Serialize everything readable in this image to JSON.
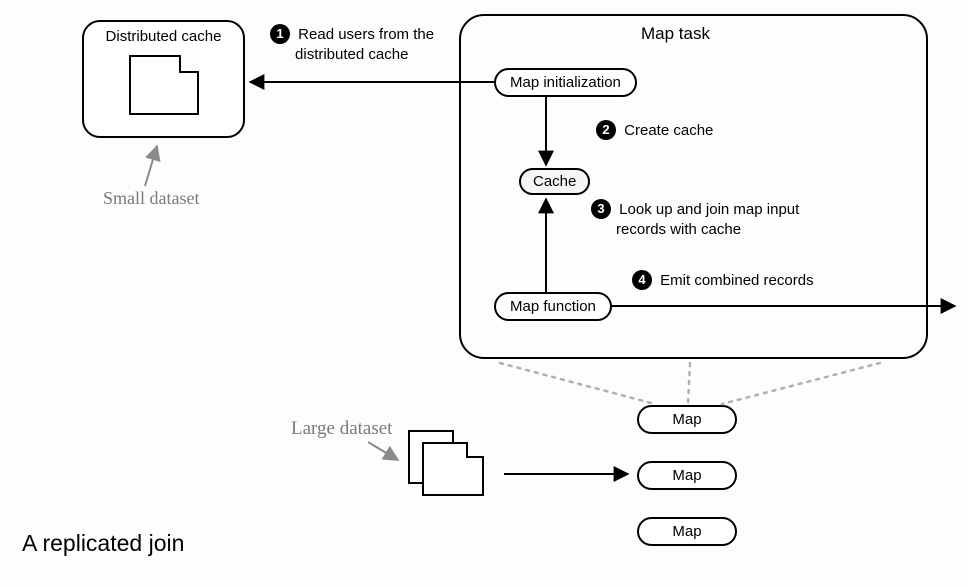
{
  "cache_box_label": "Distributed cache",
  "map_task_label": "Map task",
  "nodes": {
    "map_init": "Map initialization",
    "cache": "Cache",
    "map_func": "Map function"
  },
  "steps": {
    "s1_num": "1",
    "s1_text_a": "Read users from the",
    "s1_text_b": "distributed cache",
    "s2_num": "2",
    "s2_text": "Create cache",
    "s3_num": "3",
    "s3_text_a": "Look up and join map input",
    "s3_text_b": "records with cache",
    "s4_num": "4",
    "s4_text": "Emit combined records"
  },
  "annotations": {
    "small_dataset": "Small dataset",
    "large_dataset": "Large dataset"
  },
  "maps": {
    "m1": "Map",
    "m2": "Map",
    "m3": "Map"
  },
  "caption": "A replicated join"
}
